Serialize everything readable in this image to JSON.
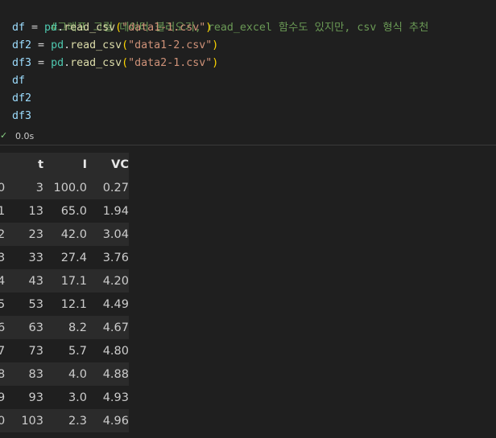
{
  "code": {
    "comment": "#그래프 그릴 데이터 불러오기, read_excel 함수도 있지만, csv 형식 추천",
    "lines": [
      {
        "var": "df",
        "eq": " = ",
        "mod": "pd",
        "dot": ".",
        "fn": "read_csv",
        "open": "(",
        "str": "\"data1-1.csv\"",
        "close": ")"
      },
      {
        "var": "df2",
        "eq": " = ",
        "mod": "pd",
        "dot": ".",
        "fn": "read_csv",
        "open": "(",
        "str": "\"data1-2.csv\"",
        "close": ")"
      },
      {
        "var": "df3",
        "eq": " = ",
        "mod": "pd",
        "dot": ".",
        "fn": "read_csv",
        "open": "(",
        "str": "\"data2-1.csv\"",
        "close": ")"
      }
    ],
    "plain_lines": [
      "df",
      "df2",
      "df3"
    ]
  },
  "status": {
    "check_glyph": "✓",
    "exec_time": "0.0s"
  },
  "table": {
    "columns": [
      "",
      "t",
      "I",
      "VC"
    ],
    "rows": [
      [
        "0",
        "3",
        "100.0",
        "0.27"
      ],
      [
        "1",
        "13",
        "65.0",
        "1.94"
      ],
      [
        "2",
        "23",
        "42.0",
        "3.04"
      ],
      [
        "3",
        "33",
        "27.4",
        "3.76"
      ],
      [
        "4",
        "43",
        "17.1",
        "4.20"
      ],
      [
        "5",
        "53",
        "12.1",
        "4.49"
      ],
      [
        "6",
        "63",
        "8.2",
        "4.67"
      ],
      [
        "7",
        "73",
        "5.7",
        "4.80"
      ],
      [
        "8",
        "83",
        "4.0",
        "4.88"
      ],
      [
        "9",
        "93",
        "3.0",
        "4.93"
      ],
      [
        "0",
        "103",
        "2.3",
        "4.96"
      ]
    ]
  },
  "colors": {
    "background": "#1f1f1f",
    "comment": "#6a9955",
    "variable": "#9cdcfe",
    "module": "#4ec9b0",
    "function": "#dcdcaa",
    "paren": "#ffd700",
    "string": "#ce9178",
    "success": "#89d185"
  }
}
